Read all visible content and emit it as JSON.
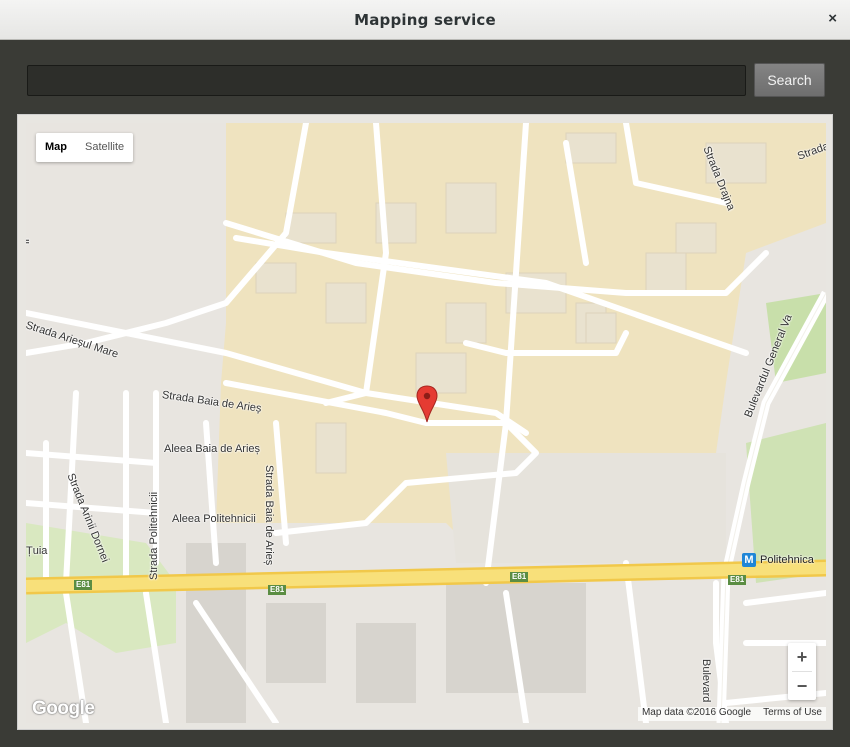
{
  "window": {
    "title": "Mapping service",
    "close_glyph": "×"
  },
  "search": {
    "value": "",
    "placeholder": "",
    "button_label": "Search"
  },
  "map": {
    "type_control": {
      "map_label": "Map",
      "satellite_label": "Satellite",
      "selected": "Map"
    },
    "zoom": {
      "in_label": "+",
      "out_label": "−"
    },
    "logo_text": "Google",
    "attribution": {
      "data": "Map data ©2016 Google",
      "terms": "Terms of Use"
    },
    "labels": {
      "strada_drajna": "Strada Drajna",
      "strada_top_right": "Strada",
      "ariesul_mare": "Strada Arieșul Mare",
      "baia_de_aries": "Strada Baia de Arieș",
      "aleea_baia": "Aleea Baia de Arieș",
      "strada_baia_vertical": "Strada Baia de Arieș",
      "arinii_dornei": "Strada Arinii Dornei",
      "politehnicii_vertical": "Strada Politehnicii",
      "aleea_politehnicii": "Aleea Politehnicii",
      "tuia": "Țuia",
      "general_vasile": "Bulevardul General Va",
      "bulevard_bottom": "Bulevard",
      "left_edge": "ii"
    },
    "route_shields": [
      "E81",
      "E81",
      "E81",
      "E81"
    ],
    "metro": {
      "icon": "M",
      "name": "Politehnica"
    },
    "colors": {
      "campus": "#efe3bf",
      "road": "#ffffff",
      "highway": "#f6d659",
      "park": "#c8dfaa",
      "marker": "#e53b32"
    }
  }
}
